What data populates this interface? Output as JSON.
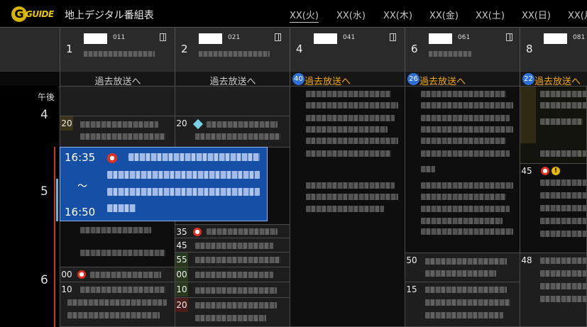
{
  "app": {
    "logo_text": "GUIDE",
    "logo_letter": "G",
    "title": "地上デジタル番組表"
  },
  "days": [
    "XX(火)",
    "XX(水)",
    "XX(木)",
    "XX(金)",
    "XX(土)",
    "XX(日)",
    "XX(月)"
  ],
  "channels": [
    {
      "num": "1",
      "code": "011",
      "past": "過去放送へ",
      "badge": ""
    },
    {
      "num": "2",
      "code": "021",
      "past": "過去放送へ",
      "badge": ""
    },
    {
      "num": "4",
      "code": "041",
      "past": "過去放送へ",
      "badge": "40"
    },
    {
      "num": "6",
      "code": "061",
      "past": "過去放送へ",
      "badge": "26"
    },
    {
      "num": "8",
      "code": "081",
      "past": "過去放送へ",
      "badge": "22"
    }
  ],
  "time": {
    "period": "午後",
    "hours": [
      "4",
      "5",
      "6"
    ]
  },
  "selected": {
    "start": "16:35",
    "tilde": "〜",
    "end": "16:50"
  },
  "minutes": {
    "ch1": [
      "20",
      "00",
      "10"
    ],
    "ch2": [
      "20",
      "35",
      "45",
      "55",
      "00",
      "10",
      "20"
    ],
    "ch6": [
      "50",
      "15"
    ],
    "ch8": [
      "45",
      "48"
    ]
  },
  "colors": {
    "accent": "#f5a800",
    "selected_bg": "#1650a6",
    "badge": "#2c6fd6"
  }
}
